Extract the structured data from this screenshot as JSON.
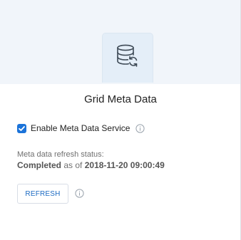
{
  "card": {
    "title": "Grid Meta Data",
    "icon": "database-refresh-icon"
  },
  "service": {
    "checkbox_label": "Enable Meta Data Service",
    "checked": true,
    "info_icon": "info-icon"
  },
  "status": {
    "label": "Meta data refresh status:",
    "state": "Completed",
    "as_of_text": "as of",
    "timestamp": "2018-11-20 09:00:49"
  },
  "actions": {
    "refresh_label": "REFRESH",
    "info_icon": "info-icon"
  },
  "colors": {
    "accent": "#1b73d9",
    "header_bg": "#f1f5fa",
    "tile_bg": "#e4eef8"
  }
}
